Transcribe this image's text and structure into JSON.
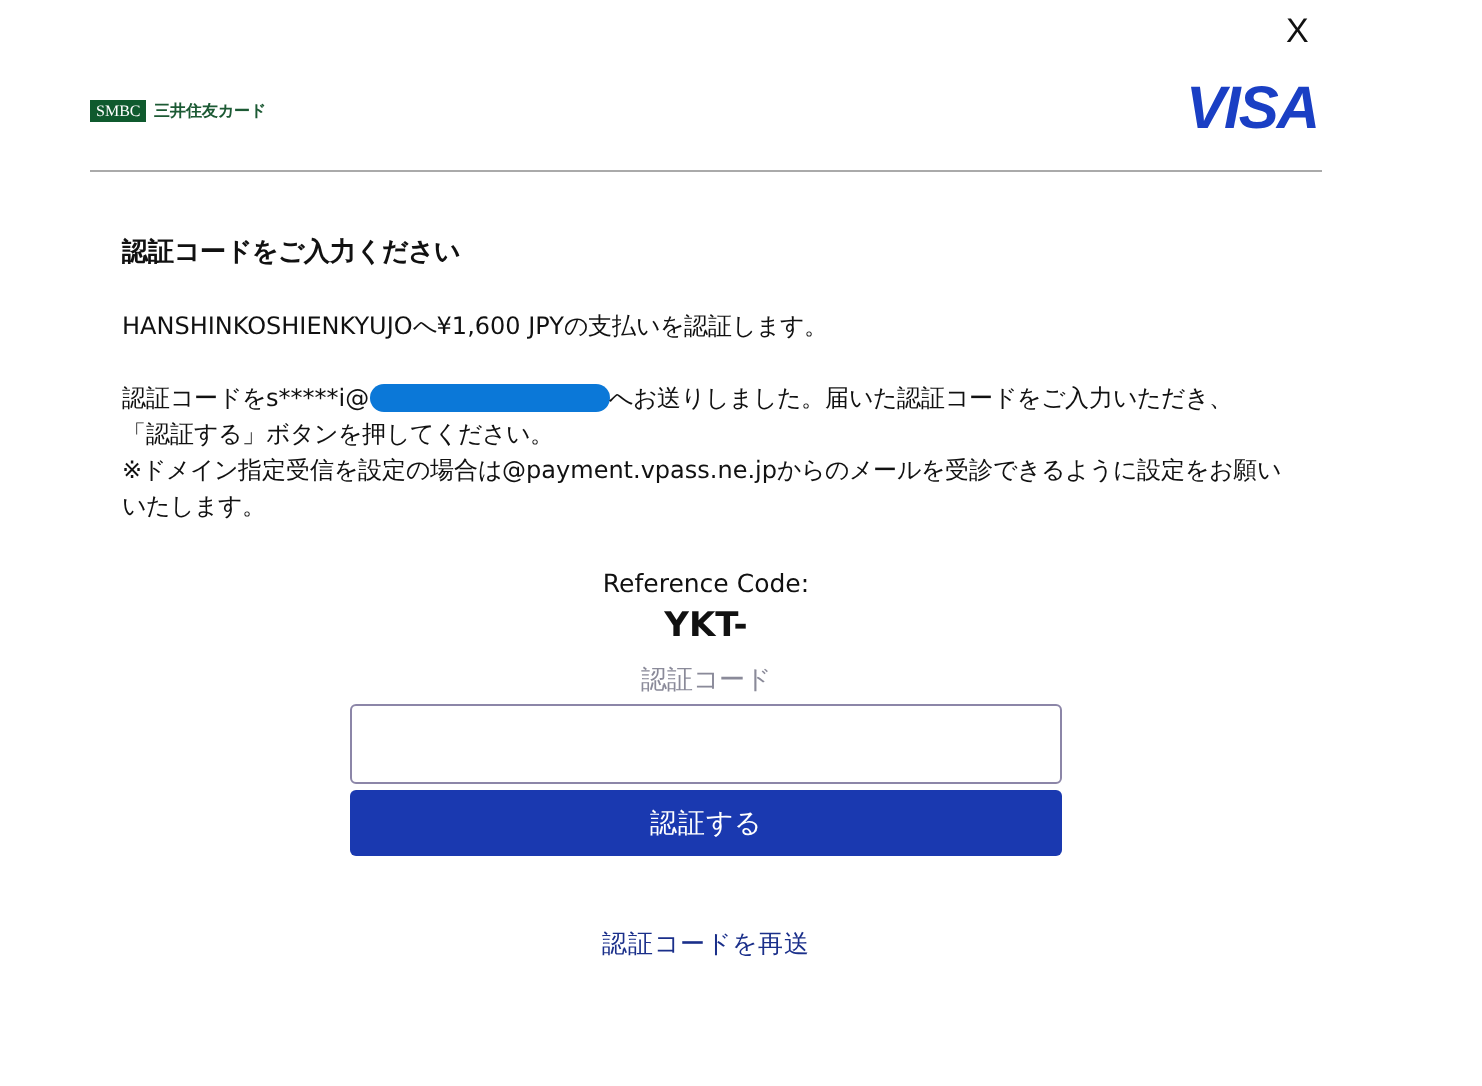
{
  "close": "X",
  "issuer_logo": {
    "badge": "SMBC",
    "name": "三井住友カード"
  },
  "brand": "VISA",
  "title": "認証コードをご入力ください",
  "payment_line": "HANSHINKOSHIENKYUJOへ¥1,600 JPYの支払いを認証します。",
  "message": {
    "before": "認証コードをs*****i@",
    "redacted": true,
    "after": "へお送りしました。届いた認証コードをご入力いただき、",
    "line_2": "「認証する」ボタンを押してください。"
  },
  "note": "※ドメイン指定受信を設定の場合は@payment.vpass.ne.jpからのメールを受診できるように設定をお願いいたします。",
  "reference_label": "Reference Code:",
  "reference_code": "YKT-",
  "code_field": {
    "label": "認証コード"
  },
  "submit": "認証する",
  "resend": "認証コードを再送"
}
